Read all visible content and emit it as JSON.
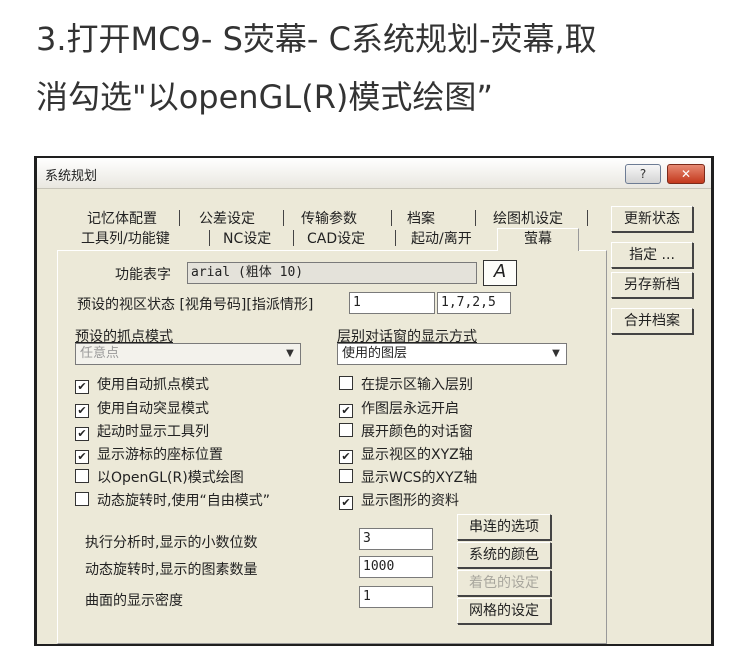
{
  "article": {
    "line1": "3.打开MC9- S荧幕- C系统规划-荧幕,取",
    "line2": "消勾选\"以openGL(R)模式绘图”"
  },
  "dialog": {
    "title": "系统规划",
    "help_label": "?",
    "close_label": "✕",
    "tabs_row1": [
      "记忆体配置",
      "公差设定",
      "传输参数",
      "档案",
      "绘图机设定"
    ],
    "tabs_row2": [
      "工具列/功能键",
      "NC设定",
      "CAD设定",
      "起动/离开"
    ],
    "active_tab": "萤幕",
    "font_label": "功能表字",
    "font_value": "arial (粗体 10)",
    "font_icon": "A",
    "view_label": "预设的视区状态 [视角号码][指派情形]",
    "view_number": "1",
    "view_assign": "1,7,2,5",
    "snap_label": "预设的抓点模式",
    "snap_value": "任意点",
    "layer_label": "层别对话窗的显示方式",
    "layer_value": "使用的图层",
    "checks_left": [
      {
        "label": "使用自动抓点模式",
        "checked": "✔"
      },
      {
        "label": "使用自动突显模式",
        "checked": "✔"
      },
      {
        "label": "起动时显示工具列",
        "checked": "✔"
      },
      {
        "label": "显示游标的座标位置",
        "checked": "✔"
      },
      {
        "label": "以OpenGL(R)模式绘图",
        "checked": ""
      },
      {
        "label": "动态旋转时,使用“自由模式”",
        "checked": ""
      }
    ],
    "checks_right": [
      {
        "label": "在提示区输入层别",
        "checked": ""
      },
      {
        "label": "作图层永远开启",
        "checked": "✔"
      },
      {
        "label": "展开颜色的对话窗",
        "checked": ""
      },
      {
        "label": "显示视区的XYZ轴",
        "checked": "✔"
      },
      {
        "label": "显示WCS的XYZ轴",
        "checked": ""
      },
      {
        "label": "显示图形的资料",
        "checked": "✔"
      }
    ],
    "decimals_label": "执行分析时,显示的小数位数",
    "decimals_value": "3",
    "rotate_label": "动态旋转时,显示的图素数量",
    "rotate_value": "1000",
    "density_label": "曲面的显示密度",
    "density_value": "1",
    "btn_chain": "串连的选项",
    "btn_colors": "系统的颜色",
    "btn_shade": "着色的设定",
    "btn_grid": "网格的设定",
    "side_buttons": [
      "更新状态",
      "指定 ...",
      "另存新档",
      "合并档案"
    ]
  }
}
